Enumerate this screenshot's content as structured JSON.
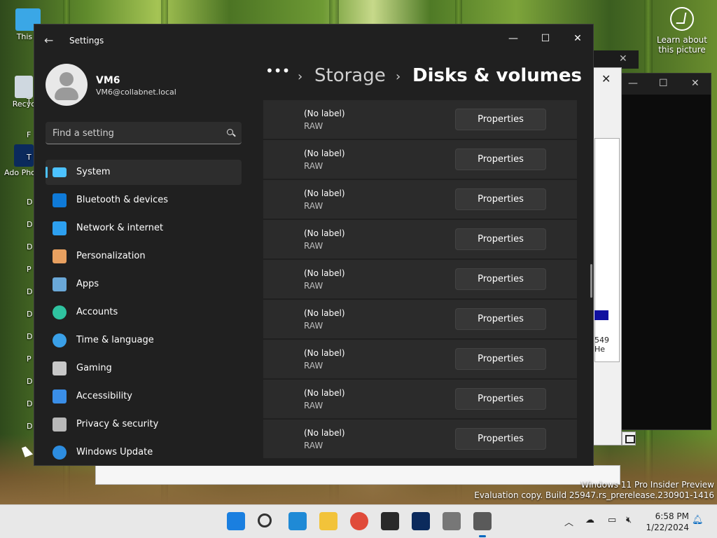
{
  "desktop": {
    "icons": [
      {
        "label": "This P",
        "icon": "monitor-icon"
      },
      {
        "label": "Recyc",
        "icon": "recycle-bin-icon"
      },
      {
        "label": "Ado Photo",
        "icon": "photoshop-icon"
      }
    ],
    "letters": [
      "T",
      "F",
      "T",
      "D",
      "D",
      "D",
      "P",
      "D",
      "D",
      "D",
      "P",
      "D",
      "D",
      "D"
    ],
    "learn_about": "Learn about this picture"
  },
  "watermark": {
    "line1": "Windows 11 Pro Insider Preview",
    "line2": "Evaluation copy. Build 25947.rs_prerelease.230901-1416"
  },
  "bg_windows": {
    "snippet1": "549",
    "snippet2": "He"
  },
  "settings": {
    "app_title": "Settings",
    "user": {
      "name": "VM6",
      "email": "VM6@collabnet.local"
    },
    "search": {
      "placeholder": "Find a setting"
    },
    "nav": [
      {
        "label": "System",
        "icon": "system-icon",
        "color": "#4cc2ff",
        "active": true
      },
      {
        "label": "Bluetooth & devices",
        "icon": "bluetooth-icon",
        "color": "#0f7ad8"
      },
      {
        "label": "Network & internet",
        "icon": "wifi-icon",
        "color": "#2da0f0"
      },
      {
        "label": "Personalization",
        "icon": "brush-icon",
        "color": "#e8a060"
      },
      {
        "label": "Apps",
        "icon": "apps-icon",
        "color": "#6aa8d8"
      },
      {
        "label": "Accounts",
        "icon": "accounts-icon",
        "color": "#2fc3a0"
      },
      {
        "label": "Time & language",
        "icon": "globe-clock-icon",
        "color": "#3aa0e8"
      },
      {
        "label": "Gaming",
        "icon": "gamepad-icon",
        "color": "#c8c8c8"
      },
      {
        "label": "Accessibility",
        "icon": "accessibility-icon",
        "color": "#3a8ee8"
      },
      {
        "label": "Privacy & security",
        "icon": "shield-icon",
        "color": "#b8b8b8"
      },
      {
        "label": "Windows Update",
        "icon": "update-icon",
        "color": "#2d8de0"
      }
    ],
    "breadcrumb": {
      "more": "•••",
      "parent": "Storage",
      "current": "Disks & volumes"
    },
    "volumes": [
      {
        "label": "(No label)",
        "type": "RAW",
        "button": "Properties"
      },
      {
        "label": "(No label)",
        "type": "RAW",
        "button": "Properties"
      },
      {
        "label": "(No label)",
        "type": "RAW",
        "button": "Properties"
      },
      {
        "label": "(No label)",
        "type": "RAW",
        "button": "Properties"
      },
      {
        "label": "(No label)",
        "type": "RAW",
        "button": "Properties"
      },
      {
        "label": "(No label)",
        "type": "RAW",
        "button": "Properties"
      },
      {
        "label": "(No label)",
        "type": "RAW",
        "button": "Properties"
      },
      {
        "label": "(No label)",
        "type": "RAW",
        "button": "Properties"
      },
      {
        "label": "(No label)",
        "type": "RAW",
        "button": "Properties"
      }
    ]
  },
  "taskbar": {
    "apps": [
      {
        "name": "start-icon",
        "color": "#1a7fe0"
      },
      {
        "name": "search-icon",
        "color": "#333333"
      },
      {
        "name": "edge-icon",
        "color": "#1f8ad6"
      },
      {
        "name": "file-explorer-icon",
        "color": "#f2c33a"
      },
      {
        "name": "chrome-icon",
        "color": "#e04b3a"
      },
      {
        "name": "terminal-icon",
        "color": "#2a2a2a"
      },
      {
        "name": "photoshop-icon",
        "color": "#0b2a5c"
      },
      {
        "name": "package-icon",
        "color": "#777777"
      },
      {
        "name": "settings-icon",
        "color": "#5a5a5a",
        "active": true
      }
    ],
    "time": "6:58 PM",
    "date": "1/22/2024"
  }
}
